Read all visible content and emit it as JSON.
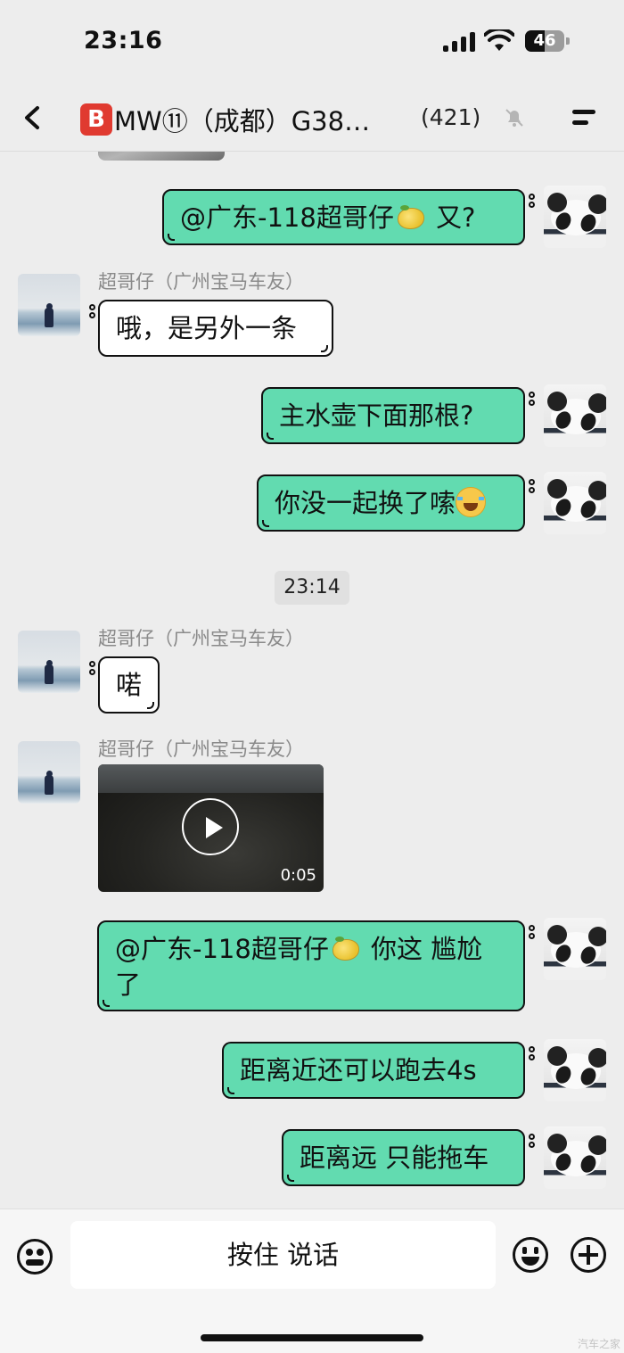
{
  "status_bar": {
    "time": "23:16",
    "battery": "46"
  },
  "nav": {
    "title": "MW⑪（成都）G38…",
    "badge": "B",
    "member_count": "(421)"
  },
  "messages": {
    "m1": {
      "text": "@广东-118超哥仔",
      "suffix": " 又?"
    },
    "m2_sender": "超哥仔（广州宝马车友）",
    "m2": "哦，是另外一条",
    "m3": "主水壶下面那根?",
    "m4": "你没一起换了嗦",
    "timestamp": "23:14",
    "m5_sender": "超哥仔（广州宝马车友）",
    "m5": "喏",
    "m6_sender": "超哥仔（广州宝马车友）",
    "m6_video_duration": "0:05",
    "m7": {
      "text": "@广东-118超哥仔",
      "suffix": " 你这 尴尬了"
    },
    "m8": "距离近还可以跑去4s",
    "m9": "距离远 只能拖车"
  },
  "input_bar": {
    "hold_to_talk": "按住 说话"
  },
  "watermark": "汽车之家",
  "icons": {
    "back": "chevron-left-icon",
    "moon": "moon-icon",
    "mute": "bell-slash-icon",
    "more": "menu-icon",
    "voice": "voice-icon",
    "emoji": "emoji-icon",
    "plus": "plus-icon",
    "play": "play-icon",
    "lemon": "lemon-emoji",
    "laugh": "laughing-emoji"
  },
  "colors": {
    "my_bubble": "#62dbb0",
    "their_bubble": "#ffffff",
    "background": "#ededed",
    "badge": "#e03a30"
  }
}
